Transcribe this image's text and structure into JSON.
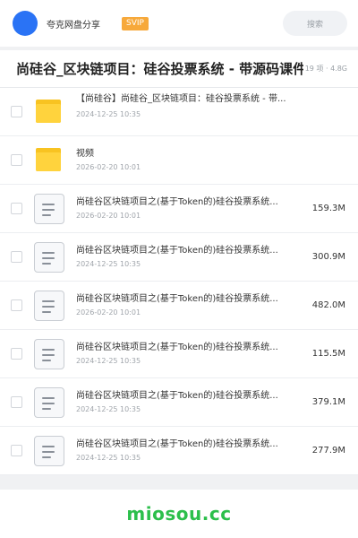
{
  "header": {
    "site_name": "夸克网盘分享",
    "badge": "SVIP",
    "search_label": "搜索"
  },
  "share": {
    "title": "尚硅谷_区块链项目：硅谷投票系统 - 带源码课件",
    "meta": "19 项 · 4.8G"
  },
  "files": [
    {
      "type": "folder",
      "name": "【尚硅谷】尚硅谷_区块链项目：硅谷投票系统 - 带...",
      "date": "2024-12-25 10:35",
      "size": ""
    },
    {
      "type": "folder",
      "name": "视频",
      "date": "2026-02-20 10:01",
      "size": ""
    },
    {
      "type": "file",
      "name": "尚硅谷区块链项目之(基于Token的)硅谷投票系统...",
      "date": "2026-02-20 10:01",
      "size": "159.3M"
    },
    {
      "type": "file",
      "name": "尚硅谷区块链项目之(基于Token的)硅谷投票系统...",
      "date": "2024-12-25 10:35",
      "size": "300.9M"
    },
    {
      "type": "file",
      "name": "尚硅谷区块链项目之(基于Token的)硅谷投票系统...",
      "date": "2026-02-20 10:01",
      "size": "482.0M"
    },
    {
      "type": "file",
      "name": "尚硅谷区块链项目之(基于Token的)硅谷投票系统...",
      "date": "2024-12-25 10:35",
      "size": "115.5M"
    },
    {
      "type": "file",
      "name": "尚硅谷区块链项目之(基于Token的)硅谷投票系统...",
      "date": "2024-12-25 10:35",
      "size": "379.1M"
    },
    {
      "type": "file",
      "name": "尚硅谷区块链项目之(基于Token的)硅谷投票系统...",
      "date": "2024-12-25 10:35",
      "size": "277.9M"
    }
  ],
  "footer": {
    "brand": "miosou.cc"
  },
  "colors": {
    "accent": "#2a73f5",
    "badge": "#f7a93b",
    "folder": "#ffd33d",
    "brand": "#2cbf4b"
  }
}
